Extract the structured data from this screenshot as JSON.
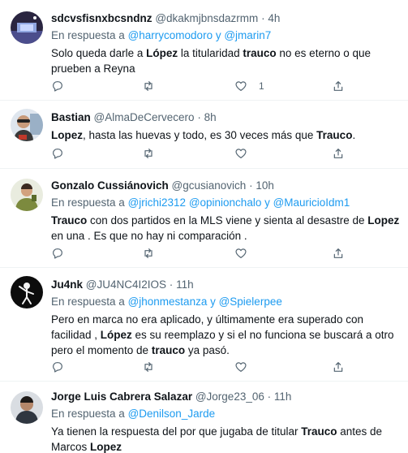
{
  "tweets": [
    {
      "name": "sdcvsfisnxbcsndnz",
      "handle": "@dkakmjbnsdazrmm",
      "dot": "·",
      "time": "4h",
      "reply_prefix": "En respuesta a",
      "reply_mentions": "@harrycomodoro y @jmarin7",
      "text_parts": [
        "Solo queda darle a ",
        "López",
        " la titularidad ",
        "trauco",
        " no es eterno o que prueben a Reyna"
      ],
      "like_count": "1",
      "avatar": "dark-space-scene"
    },
    {
      "name": "Bastian",
      "handle": "@AlmaDeCervecero",
      "dot": "·",
      "time": "8h",
      "text_parts": [
        "Lopez",
        ", hasta las huevas y todo, es 30 veces más que ",
        "Trauco",
        "."
      ],
      "like_count": "",
      "avatar": "person-sunglasses"
    },
    {
      "name": "Gonzalo Cussiánovich",
      "handle": "@gcusianovich",
      "dot": "·",
      "time": "10h",
      "reply_prefix": "En respuesta a",
      "reply_mentions": "@jrichi2312 @opinionchalo y @MauricioIdm1",
      "text_parts": [
        "Trauco",
        " con dos partidos en la MLS viene y sienta al desastre de ",
        "Lopez",
        " en una . Es que no hay ni comparación ."
      ],
      "like_count": "",
      "avatar": "person-green"
    },
    {
      "name": "Ju4nk",
      "handle": "@JU4NC4I2IOS",
      "dot": "·",
      "time": "11h",
      "reply_prefix": "En respuesta a",
      "reply_mentions": "@jhonmestanza y @Spielerpee",
      "text_parts": [
        "Pero en marca no era aplicado, y últimamente era superado con facilidad , ",
        "López",
        " es su reemplazo y si el no funciona se buscará a otro pero el momento de ",
        "trauco",
        " ya pasó."
      ],
      "like_count": "",
      "avatar": "skeleton-dab"
    },
    {
      "name": "Jorge Luis Cabrera Salazar",
      "handle": "@Jorge23_06",
      "dot": "·",
      "time": "11h",
      "reply_prefix": "En respuesta a",
      "reply_mentions": "@Denilson_Jarde",
      "text_parts": [
        "Ya tienen la respuesta del por que jugaba de titular ",
        "Trauco",
        " antes de Marcos ",
        "Lopez"
      ],
      "like_count": "",
      "avatar": "person-portrait"
    }
  ],
  "colors": {
    "accent": "#1d9bf0",
    "secondary_text": "#536471",
    "divider": "#eff3f4"
  },
  "icons": [
    "reply-icon",
    "retweet-icon",
    "like-icon",
    "share-icon"
  ]
}
